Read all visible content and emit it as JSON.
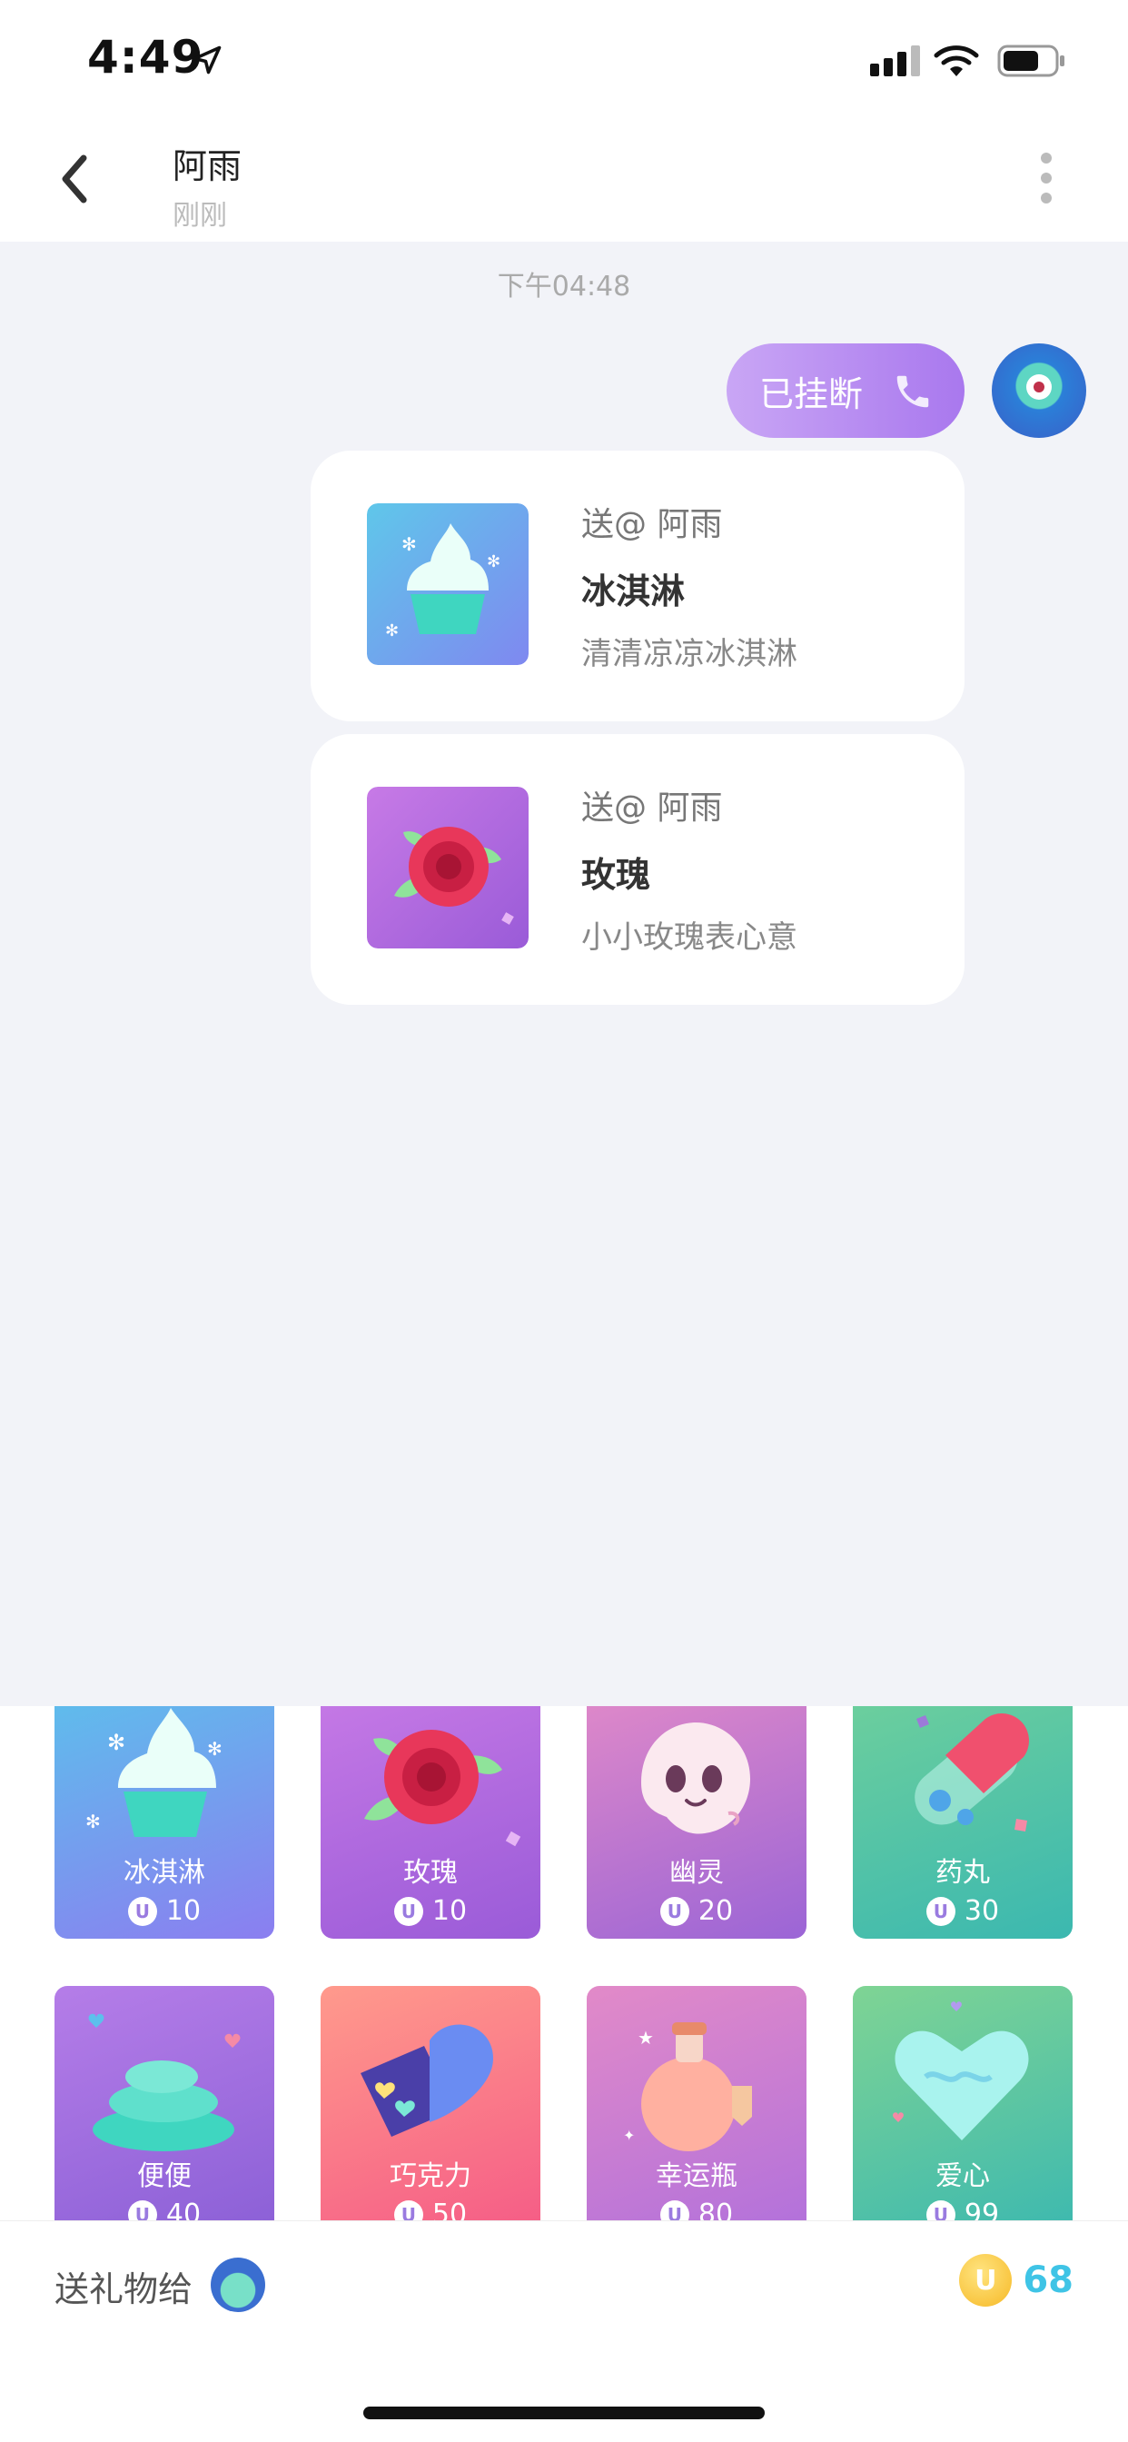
{
  "status_bar": {
    "time": "4:49",
    "icons": [
      "location-arrow-icon",
      "cellular-signal-icon",
      "wifi-icon",
      "battery-icon"
    ]
  },
  "header": {
    "title": "阿雨",
    "subtitle": "刚刚",
    "icons": [
      "back-chevron-icon",
      "more-vertical-icon"
    ]
  },
  "chat": {
    "timestamp": "下午04:48",
    "call_bubble": {
      "label": "已挂断",
      "icon": "phone-icon"
    },
    "gift_messages": [
      {
        "to": "送@ 阿雨",
        "name": "冰淇淋",
        "desc": "清清凉凉冰淇淋",
        "icon": "ice-cream-icon"
      },
      {
        "to": "送@ 阿雨",
        "name": "玫瑰",
        "desc": "小小玫瑰表心意",
        "icon": "rose-icon"
      }
    ]
  },
  "gifts": [
    {
      "name": "冰淇淋",
      "price": "10",
      "icon": "ice-cream-icon"
    },
    {
      "name": "玫瑰",
      "price": "10",
      "icon": "rose-icon"
    },
    {
      "name": "幽灵",
      "price": "20",
      "icon": "ghost-icon"
    },
    {
      "name": "药丸",
      "price": "30",
      "icon": "pill-icon"
    },
    {
      "name": "便便",
      "price": "40",
      "icon": "poop-icon"
    },
    {
      "name": "巧克力",
      "price": "50",
      "icon": "chocolate-icon"
    },
    {
      "name": "幸运瓶",
      "price": "80",
      "icon": "lucky-bottle-icon"
    },
    {
      "name": "爱心",
      "price": "99",
      "icon": "heart-icon"
    }
  ],
  "coin_symbol": "U",
  "footer": {
    "send_to_label": "送礼物给",
    "balance": "68",
    "balance_icon": "coin-icon"
  },
  "colors": {
    "chat_bg": "#f2f3f8",
    "call_bubble": "#b48cf2",
    "balance_text": "#3fc4e6"
  }
}
